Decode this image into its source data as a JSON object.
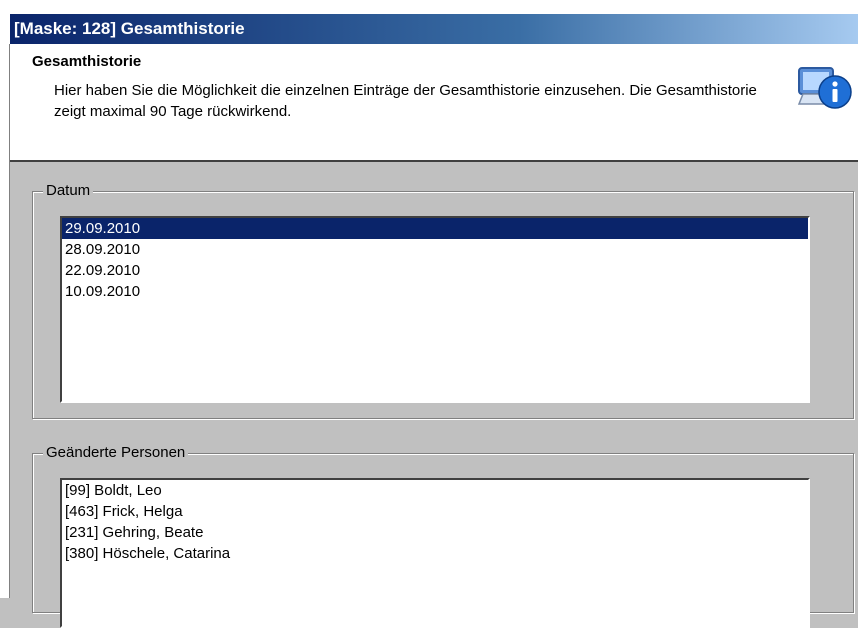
{
  "window": {
    "title": "[Maske: 128]  Gesamthistorie"
  },
  "header": {
    "title": "Gesamthistorie",
    "description": "Hier haben Sie die Möglichkeit die einzelnen Einträge der Gesamthistorie einzusehen. Die Gesamthistorie zeigt maximal 90 Tage rückwirkend.",
    "icon": "info-computer-icon"
  },
  "datum": {
    "legend": "Datum",
    "items": [
      "29.09.2010",
      "28.09.2010",
      "22.09.2010",
      "10.09.2010"
    ],
    "selected_index": 0
  },
  "personen": {
    "legend": "Geänderte Personen",
    "items": [
      "[99] Boldt, Leo",
      "[463] Frick, Helga",
      "[231] Gehring, Beate",
      "[380] Höschele, Catarina"
    ]
  },
  "colors": {
    "selection": "#0a246a",
    "titlebar_start": "#0a246a",
    "titlebar_end": "#a6caf0",
    "panel": "#c0c0c0"
  }
}
